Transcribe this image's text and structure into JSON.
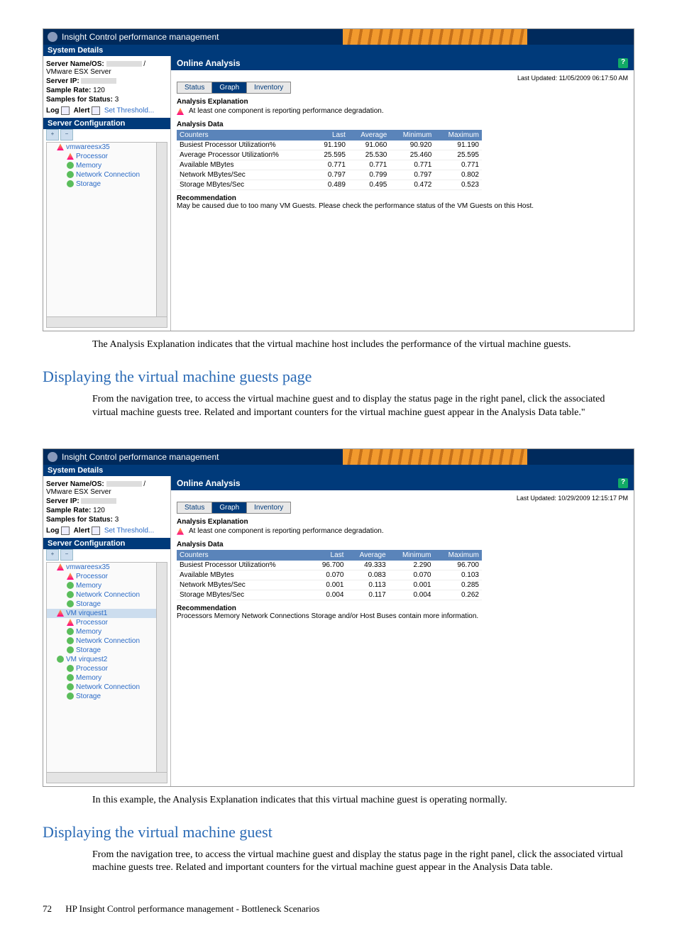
{
  "app_title": "Insight Control performance management",
  "shot1": {
    "system_details_label": "System Details",
    "server_name_os_label": "Server Name/OS:",
    "server_name_os_suffix": " / VMware ESX Server",
    "server_ip_label": "Server IP:",
    "sample_rate_label": "Sample Rate:",
    "sample_rate_value": "120",
    "samples_status_label": "Samples for Status:",
    "samples_status_value": "3",
    "log_label": "Log",
    "alert_label": "Alert",
    "set_threshold": "Set Threshold...",
    "server_config_label": "Server Configuration",
    "tree": [
      "vmwareesx35",
      "Processor",
      "Memory",
      "Network Connection",
      "Storage"
    ],
    "tree_icons": [
      "warn",
      "warn",
      "ok",
      "ok",
      "ok"
    ],
    "online_analysis": "Online Analysis",
    "last_updated": "Last Updated: 11/05/2009 06:17:50 AM",
    "tabs": [
      "Status",
      "Graph",
      "Inventory"
    ],
    "analysis_explanation_label": "Analysis Explanation",
    "analysis_explanation_text": "At least one component is reporting performance degradation.",
    "analysis_data_label": "Analysis Data",
    "table_headers": [
      "Counters",
      "Last",
      "Average",
      "Minimum",
      "Maximum"
    ],
    "rows": [
      {
        "c": "Busiest Processor Utilization%",
        "l": "91.190",
        "a": "91.060",
        "mn": "90.920",
        "mx": "91.190"
      },
      {
        "c": "Average Processor Utilization%",
        "l": "25.595",
        "a": "25.530",
        "mn": "25.460",
        "mx": "25.595"
      },
      {
        "c": "Available MBytes",
        "l": "0.771",
        "a": "0.771",
        "mn": "0.771",
        "mx": "0.771"
      },
      {
        "c": "Network MBytes/Sec",
        "l": "0.797",
        "a": "0.799",
        "mn": "0.797",
        "mx": "0.802"
      },
      {
        "c": "Storage MBytes/Sec",
        "l": "0.489",
        "a": "0.495",
        "mn": "0.472",
        "mx": "0.523"
      }
    ],
    "recommendation_label": "Recommendation",
    "recommendation_text": "May be caused due to too many VM Guests. Please check the performance status of the VM Guests on this Host."
  },
  "para1": "The Analysis Explanation indicates that the virtual machine host includes the performance of the virtual machine guests.",
  "heading1": "Displaying the virtual machine guests page",
  "para2": "From the navigation tree, to access the virtual machine guest and to display the status page in the right panel, click the associated virtual machine guests tree. Related and important counters for the virtual machine guest appear in the Analysis Data table.\"",
  "shot2": {
    "system_details_label": "System Details",
    "server_name_os_label": "Server Name/OS:",
    "server_name_os_suffix": " / VMware ESX Server",
    "server_ip_label": "Server IP:",
    "sample_rate_label": "Sample Rate:",
    "sample_rate_value": "120",
    "samples_status_label": "Samples for Status:",
    "samples_status_value": "3",
    "log_label": "Log",
    "alert_label": "Alert",
    "set_threshold": "Set Threshold...",
    "server_config_label": "Server Configuration",
    "tree": [
      "vmwareesx35",
      "Processor",
      "Memory",
      "Network Connection",
      "Storage",
      "VM virquest1",
      "Processor",
      "Memory",
      "Network Connection",
      "Storage",
      "VM virquest2",
      "Processor",
      "Memory",
      "Network Connection",
      "Storage"
    ],
    "tree_icons": [
      "warn",
      "warn",
      "ok",
      "ok",
      "ok",
      "warn",
      "warn",
      "ok",
      "ok",
      "ok",
      "ok",
      "ok",
      "ok",
      "ok",
      "ok"
    ],
    "tree_selected": 5,
    "online_analysis": "Online Analysis",
    "last_updated": "Last Updated: 10/29/2009 12:15:17 PM",
    "tabs": [
      "Status",
      "Graph",
      "Inventory"
    ],
    "analysis_explanation_label": "Analysis Explanation",
    "analysis_explanation_text": "At least one component is reporting performance degradation.",
    "analysis_data_label": "Analysis Data",
    "table_headers": [
      "Counters",
      "Last",
      "Average",
      "Minimum",
      "Maximum"
    ],
    "rows": [
      {
        "c": "Busiest Processor Utilization%",
        "l": "96.700",
        "a": "49.333",
        "mn": "2.290",
        "mx": "96.700"
      },
      {
        "c": "Available MBytes",
        "l": "0.070",
        "a": "0.083",
        "mn": "0.070",
        "mx": "0.103"
      },
      {
        "c": "Network MBytes/Sec",
        "l": "0.001",
        "a": "0.113",
        "mn": "0.001",
        "mx": "0.285"
      },
      {
        "c": "Storage MBytes/Sec",
        "l": "0.004",
        "a": "0.117",
        "mn": "0.004",
        "mx": "0.262"
      }
    ],
    "recommendation_label": "Recommendation",
    "recommendation_text": "Processors Memory Network Connections Storage and/or Host Buses contain more information."
  },
  "para3": "In this example, the Analysis Explanation indicates that this virtual machine guest is operating normally.",
  "heading2": "Displaying the virtual machine guest",
  "para4": "From the navigation tree, to access the virtual machine guest and display the status page in the right panel, click the associated virtual machine guests tree. Related and important counters for the virtual machine guest appear in the Analysis Data table.",
  "footer_page": "72",
  "footer_text": "HP Insight Control performance management - Bottleneck Scenarios",
  "chart_data": [
    {
      "type": "table",
      "title": "Analysis Data (VM Host)",
      "columns": [
        "Counters",
        "Last",
        "Average",
        "Minimum",
        "Maximum"
      ],
      "rows": [
        [
          "Busiest Processor Utilization%",
          91.19,
          91.06,
          90.92,
          91.19
        ],
        [
          "Average Processor Utilization%",
          25.595,
          25.53,
          25.46,
          25.595
        ],
        [
          "Available MBytes",
          0.771,
          0.771,
          0.771,
          0.771
        ],
        [
          "Network MBytes/Sec",
          0.797,
          0.799,
          0.797,
          0.802
        ],
        [
          "Storage MBytes/Sec",
          0.489,
          0.495,
          0.472,
          0.523
        ]
      ]
    },
    {
      "type": "table",
      "title": "Analysis Data (VM Guest virquest1)",
      "columns": [
        "Counters",
        "Last",
        "Average",
        "Minimum",
        "Maximum"
      ],
      "rows": [
        [
          "Busiest Processor Utilization%",
          96.7,
          49.333,
          2.29,
          96.7
        ],
        [
          "Available MBytes",
          0.07,
          0.083,
          0.07,
          0.103
        ],
        [
          "Network MBytes/Sec",
          0.001,
          0.113,
          0.001,
          0.285
        ],
        [
          "Storage MBytes/Sec",
          0.004,
          0.117,
          0.004,
          0.262
        ]
      ]
    }
  ]
}
